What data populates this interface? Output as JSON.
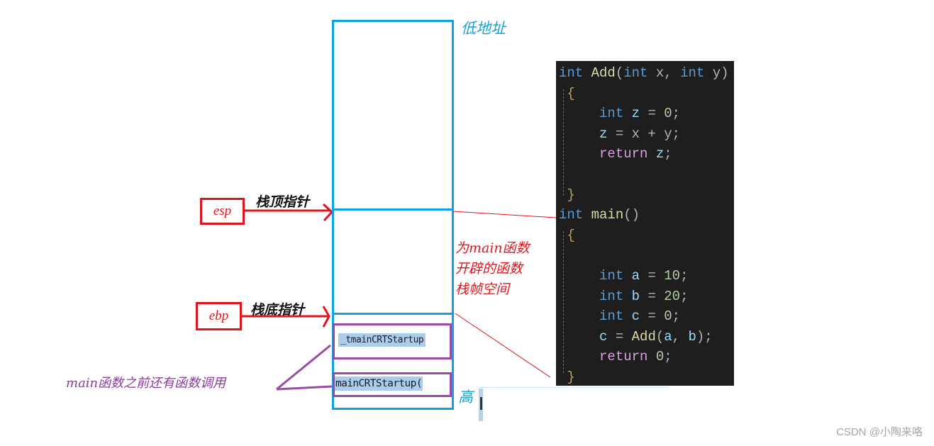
{
  "labels": {
    "low_address": "低地址",
    "high_address": "高",
    "stack_top_pointer": "栈顶指针",
    "stack_bottom_pointer": "栈底指针",
    "frame_note": [
      "为main函数",
      "开辟的函数",
      "栈帧空间"
    ],
    "prior_calls_note": "main函数之前还有函数调用"
  },
  "registers": {
    "esp": "esp",
    "ebp": "ebp"
  },
  "call_frames": [
    {
      "name": "_tmainCRTStartup"
    },
    {
      "name": "mainCRTStartup("
    }
  ],
  "code": {
    "lines": [
      [
        {
          "t": "int",
          "c": "kw"
        },
        {
          "t": " "
        },
        {
          "t": "Add",
          "c": "fn"
        },
        {
          "t": "(",
          "c": "punc"
        },
        {
          "t": "int",
          "c": "kw"
        },
        {
          "t": " x, ",
          "c": "punc"
        },
        {
          "t": "int",
          "c": "kw"
        },
        {
          "t": " y)",
          "c": "punc"
        }
      ],
      [
        {
          "t": " {",
          "c": "brace"
        }
      ],
      [
        {
          "t": "     "
        },
        {
          "t": "int",
          "c": "kw"
        },
        {
          "t": " "
        },
        {
          "t": "z",
          "c": "var"
        },
        {
          "t": " = ",
          "c": "punc"
        },
        {
          "t": "0",
          "c": "num"
        },
        {
          "t": ";",
          "c": "punc"
        }
      ],
      [
        {
          "t": "     "
        },
        {
          "t": "z",
          "c": "var"
        },
        {
          "t": " = x + y;",
          "c": "punc"
        }
      ],
      [
        {
          "t": "     "
        },
        {
          "t": "return",
          "c": "ret"
        },
        {
          "t": " "
        },
        {
          "t": "z",
          "c": "var"
        },
        {
          "t": ";",
          "c": "punc"
        }
      ],
      [],
      [
        {
          "t": " }",
          "c": "brace"
        }
      ],
      [
        {
          "t": "int",
          "c": "kw"
        },
        {
          "t": " "
        },
        {
          "t": "main",
          "c": "fn"
        },
        {
          "t": "()",
          "c": "punc"
        }
      ],
      [
        {
          "t": " {",
          "c": "brace"
        }
      ],
      [],
      [
        {
          "t": "     "
        },
        {
          "t": "int",
          "c": "kw"
        },
        {
          "t": " "
        },
        {
          "t": "a",
          "c": "var"
        },
        {
          "t": " = ",
          "c": "punc"
        },
        {
          "t": "10",
          "c": "num"
        },
        {
          "t": ";",
          "c": "punc"
        }
      ],
      [
        {
          "t": "     "
        },
        {
          "t": "int",
          "c": "kw"
        },
        {
          "t": " "
        },
        {
          "t": "b",
          "c": "var"
        },
        {
          "t": " = ",
          "c": "punc"
        },
        {
          "t": "20",
          "c": "num"
        },
        {
          "t": ";",
          "c": "punc"
        }
      ],
      [
        {
          "t": "     "
        },
        {
          "t": "int",
          "c": "kw"
        },
        {
          "t": " "
        },
        {
          "t": "c",
          "c": "var"
        },
        {
          "t": " = ",
          "c": "punc"
        },
        {
          "t": "0",
          "c": "num"
        },
        {
          "t": ";",
          "c": "punc"
        }
      ],
      [
        {
          "t": "     "
        },
        {
          "t": "c",
          "c": "var"
        },
        {
          "t": " = ",
          "c": "punc"
        },
        {
          "t": "Add",
          "c": "fn"
        },
        {
          "t": "(",
          "c": "punc"
        },
        {
          "t": "a",
          "c": "var"
        },
        {
          "t": ", ",
          "c": "punc"
        },
        {
          "t": "b",
          "c": "var"
        },
        {
          "t": ");",
          "c": "punc"
        }
      ],
      [
        {
          "t": "     "
        },
        {
          "t": "return",
          "c": "ret"
        },
        {
          "t": " "
        },
        {
          "t": "0",
          "c": "num"
        },
        {
          "t": ";",
          "c": "punc"
        }
      ],
      [
        {
          "t": " }",
          "c": "brace"
        }
      ]
    ]
  },
  "watermark": "CSDN @小陶来咯",
  "colors": {
    "stack_border": "#0ea2e3",
    "pointer_red": "#e0141c",
    "call_purple": "#9b4aa8",
    "code_bg": "#1e1e1e"
  }
}
